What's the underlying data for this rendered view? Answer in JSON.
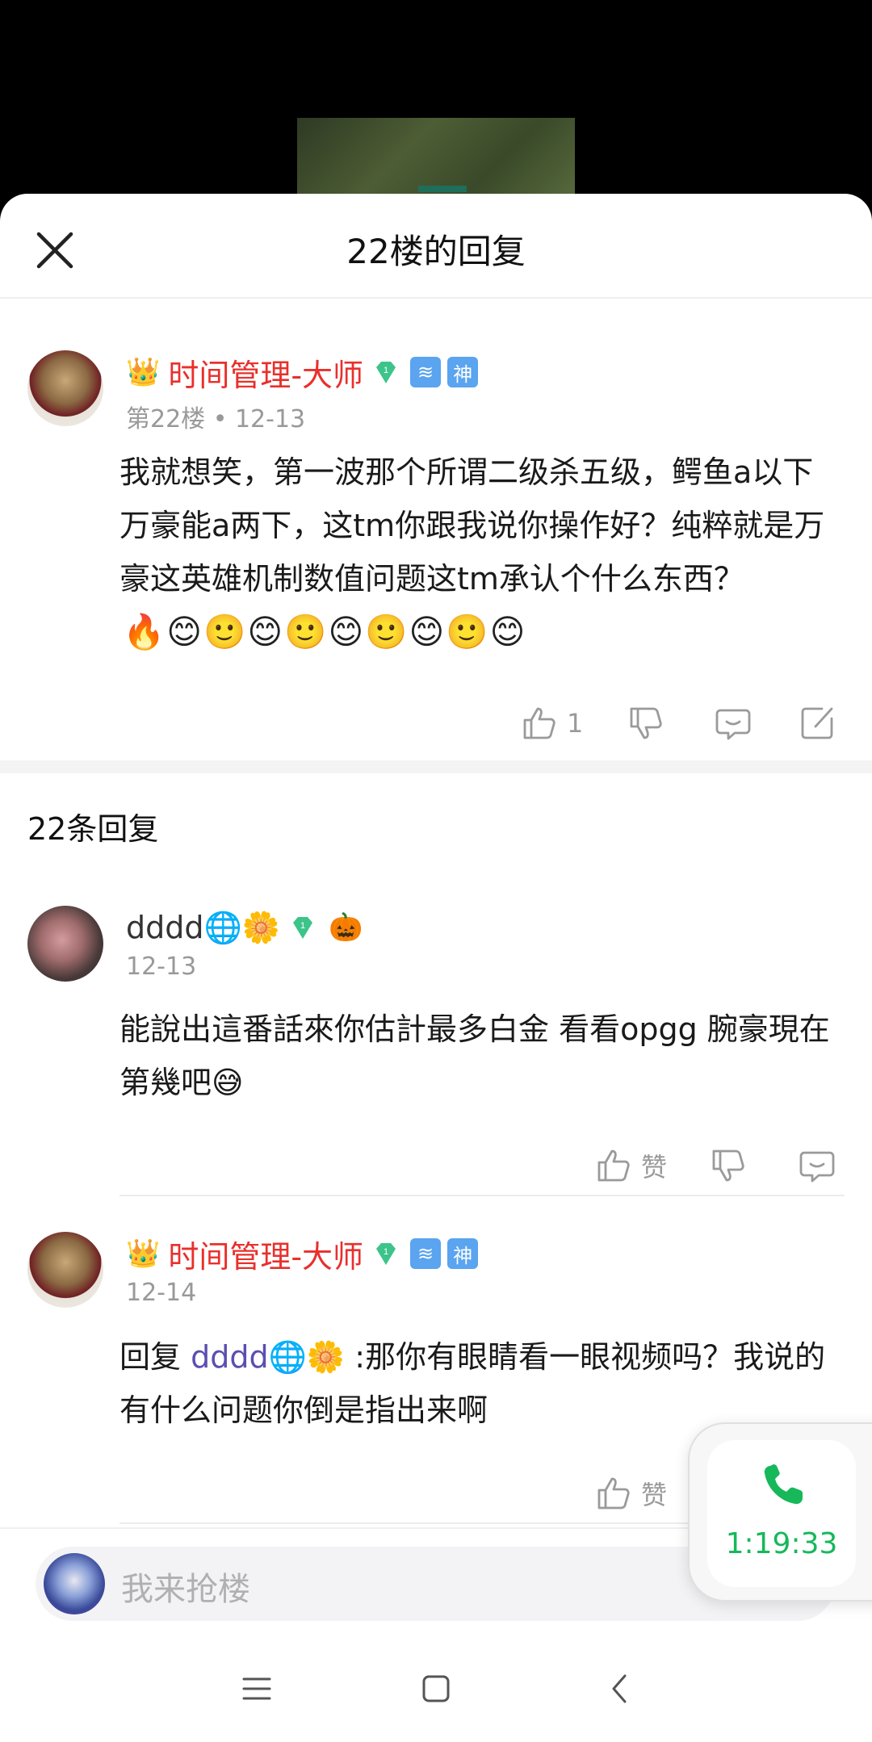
{
  "sheet": {
    "title": "22楼的回复"
  },
  "post": {
    "username": "时间管理-大师",
    "crown": "👑",
    "gem_level": "1",
    "badges": [
      "≋",
      "神"
    ],
    "meta": "第22楼 • 12-13",
    "content": "我就想笑，第一波那个所谓二级杀五级，鳄鱼a以下万豪能a两下，这tm你跟我说你操作好？纯粹就是万豪这英雄机制数值问题这tm承认个什么东西？",
    "emojis": "🔥😊🙂😊🙂😊🙂😊🙂😊",
    "like_count": "1"
  },
  "replies_header": "22条回复",
  "replies": [
    {
      "username": "dddd🌐🌼",
      "gem_level": "1",
      "extra_badge": "🎃",
      "date": "12-13",
      "content": "能說出這番話來你估計最多白金 看看opgg 腕豪現在第幾吧😅",
      "like_label": "赞"
    },
    {
      "username": "时间管理-大师",
      "crown": "👑",
      "gem_level": "1",
      "badges": [
        "≋",
        "神"
      ],
      "date": "12-14",
      "content_prefix": "回复 ",
      "mention": "dddd🌐🌼",
      "content_suffix": " :那你有眼睛看一眼视频吗？我说的有什么问题你倒是指出来啊",
      "like_label": "赞"
    }
  ],
  "input": {
    "placeholder": "我来抢楼"
  },
  "call": {
    "time": "1:19:33"
  },
  "colors": {
    "accent_red": "#e8302c",
    "call_green": "#16b85a",
    "mention": "#5a4fb0"
  }
}
